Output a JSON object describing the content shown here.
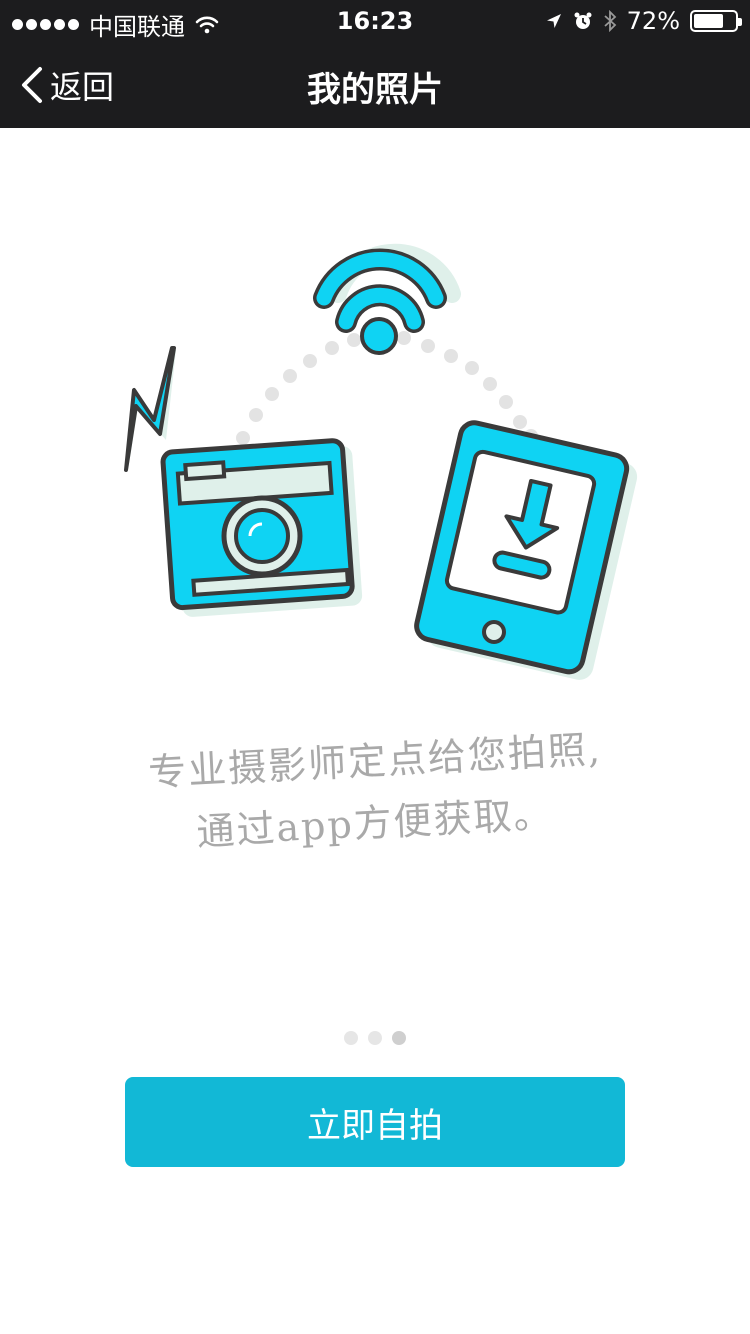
{
  "status_bar": {
    "carrier": "中国联通",
    "time": "16:23",
    "battery_percent": "72%",
    "battery_level": 0.72,
    "icons": [
      "signal-dots-icon",
      "wifi-icon",
      "location-arrow-icon",
      "alarm-icon",
      "bluetooth-icon",
      "battery-icon"
    ]
  },
  "nav": {
    "back_label": "返回",
    "title": "我的照片"
  },
  "illustration": {
    "icons": [
      "wifi-signal-icon",
      "lightning-icon",
      "camera-icon",
      "tablet-download-icon"
    ],
    "colors": {
      "accent": "#0fd3f3",
      "stroke": "#3a3a3a",
      "shadow": "#dff0ea"
    }
  },
  "caption": {
    "line1": "专业摄影师定点给您拍照,",
    "line2": "通过app方便获取。"
  },
  "pager": {
    "total": 3,
    "active": 3
  },
  "cta": {
    "label": "立即自拍",
    "color": "#12b8d6"
  }
}
